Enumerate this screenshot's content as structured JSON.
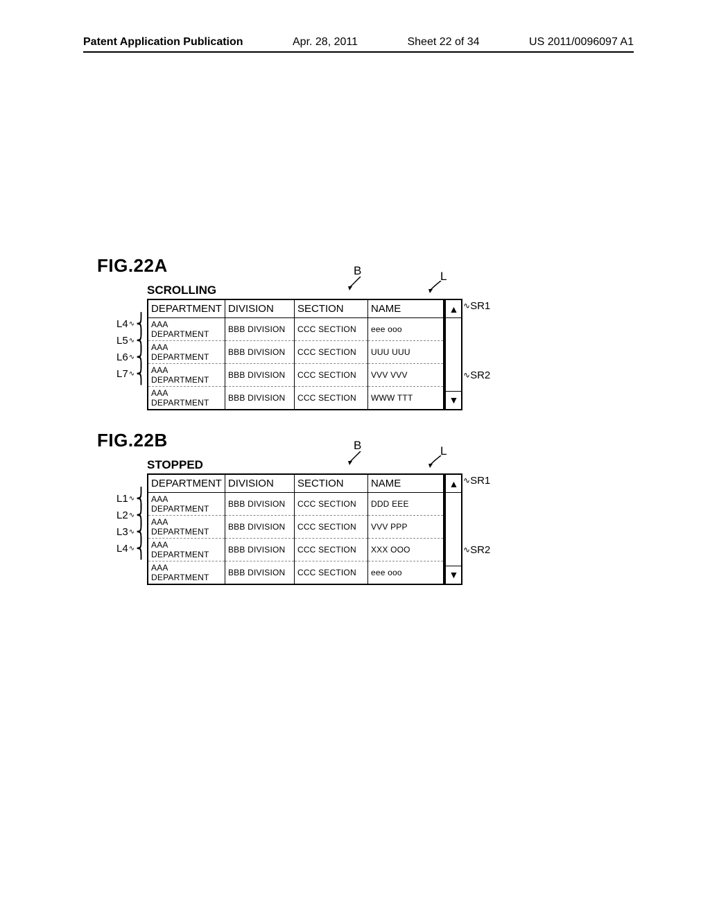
{
  "header": {
    "publication": "Patent Application Publication",
    "date": "Apr. 28, 2011",
    "sheet": "Sheet 22 of 34",
    "doc_id": "US 2011/0096097 A1"
  },
  "figures": [
    {
      "id": "figA",
      "label": "FIG.22A",
      "state": "SCROLLING",
      "columns": [
        "DEPARTMENT",
        "DIVISION",
        "SECTION",
        "NAME"
      ],
      "rows": [
        {
          "annot": "L4",
          "cells": [
            "AAA DEPARTMENT",
            "BBB DIVISION",
            "CCC SECTION",
            "eee ooo"
          ]
        },
        {
          "annot": "L5",
          "cells": [
            "AAA DEPARTMENT",
            "BBB DIVISION",
            "CCC SECTION",
            "UUU UUU"
          ]
        },
        {
          "annot": "L6",
          "cells": [
            "AAA DEPARTMENT",
            "BBB DIVISION",
            "CCC SECTION",
            "VVV VVV"
          ]
        },
        {
          "annot": "L7",
          "cells": [
            "AAA DEPARTMENT",
            "BBB DIVISION",
            "CCC SECTION",
            "WWW TTT"
          ]
        }
      ],
      "callouts": {
        "B": "B",
        "L": "L",
        "SR1": "SR1",
        "SR2": "SR2"
      }
    },
    {
      "id": "figB",
      "label": "FIG.22B",
      "state": "STOPPED",
      "columns": [
        "DEPARTMENT",
        "DIVISION",
        "SECTION",
        "NAME"
      ],
      "rows": [
        {
          "annot": "L1",
          "cells": [
            "AAA DEPARTMENT",
            "BBB DIVISION",
            "CCC SECTION",
            "DDD EEE"
          ]
        },
        {
          "annot": "L2",
          "cells": [
            "AAA DEPARTMENT",
            "BBB DIVISION",
            "CCC SECTION",
            "VVV PPP"
          ]
        },
        {
          "annot": "L3",
          "cells": [
            "AAA DEPARTMENT",
            "BBB DIVISION",
            "CCC SECTION",
            "XXX OOO"
          ]
        },
        {
          "annot": "L4",
          "cells": [
            "AAA DEPARTMENT",
            "BBB DIVISION",
            "CCC SECTION",
            "eee ooo"
          ]
        }
      ],
      "callouts": {
        "B": "B",
        "L": "L",
        "SR1": "SR1",
        "SR2": "SR2"
      }
    }
  ],
  "icons": {
    "up": "▲",
    "down": "▼",
    "tilde": "∿"
  }
}
